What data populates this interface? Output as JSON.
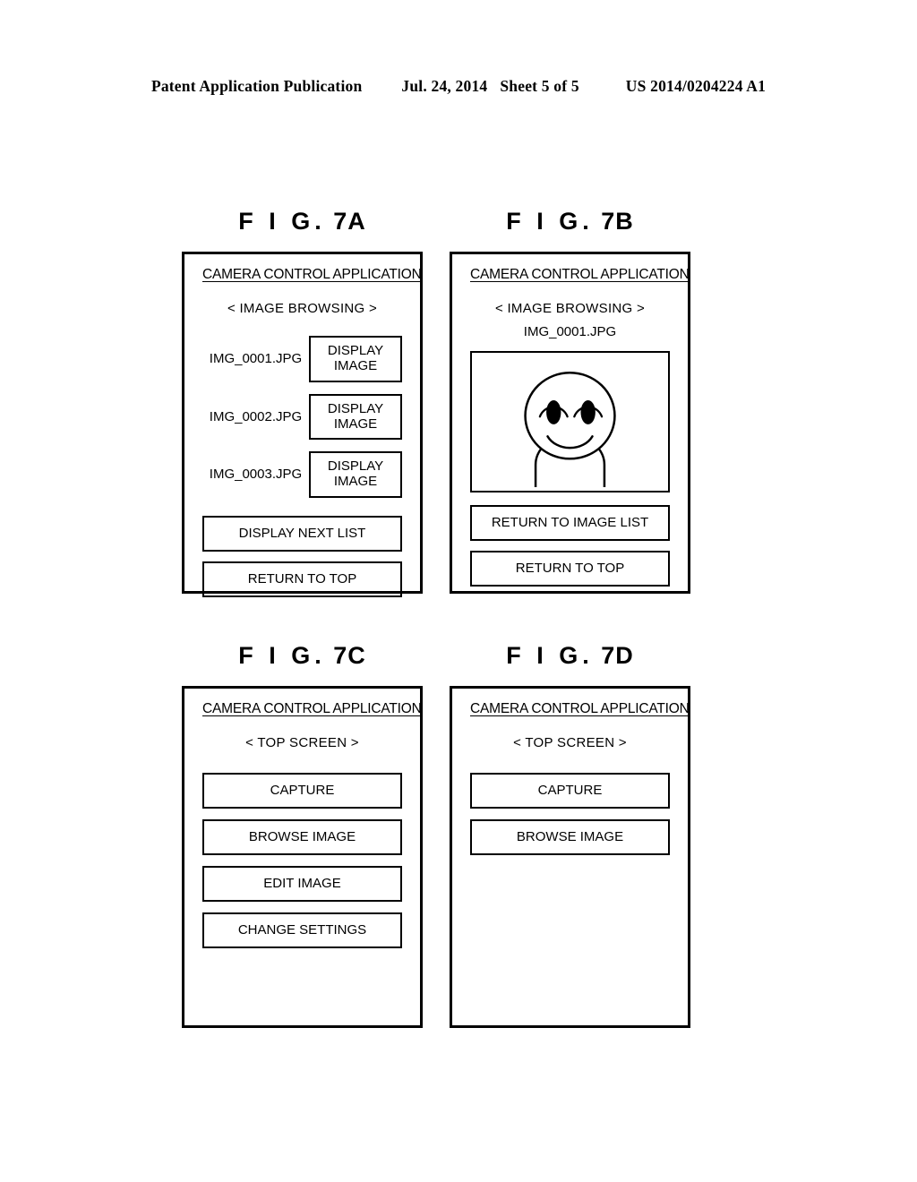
{
  "page_header": {
    "publication": "Patent Application Publication",
    "date": "Jul. 24, 2014",
    "sheet": "Sheet 5 of 5",
    "number": "US 2014/0204224 A1"
  },
  "figures": [
    {
      "caption_prefix": "F I G.",
      "caption_label": "7A",
      "app_title": "CAMERA CONTROL APPLICATION",
      "screen_name": "< IMAGE BROWSING >",
      "list": [
        {
          "file": "IMG_0001.JPG",
          "button_line1": "DISPLAY",
          "button_line2": "IMAGE"
        },
        {
          "file": "IMG_0002.JPG",
          "button_line1": "DISPLAY",
          "button_line2": "IMAGE"
        },
        {
          "file": "IMG_0003.JPG",
          "button_line1": "DISPLAY",
          "button_line2": "IMAGE"
        }
      ],
      "buttons": [
        {
          "label": "DISPLAY NEXT LIST"
        },
        {
          "label": "RETURN TO TOP"
        }
      ]
    },
    {
      "caption_prefix": "F I G.",
      "caption_label": "7B",
      "app_title": "CAMERA CONTROL APPLICATION",
      "screen_name": "< IMAGE BROWSING >",
      "file_name": "IMG_0001.JPG",
      "photo": "smiling-person-portrait",
      "buttons": [
        {
          "label": "RETURN TO IMAGE LIST"
        },
        {
          "label": "RETURN TO TOP"
        }
      ]
    },
    {
      "caption_prefix": "F I G.",
      "caption_label": "7C",
      "app_title": "CAMERA CONTROL APPLICATION",
      "screen_name": "< TOP SCREEN >",
      "buttons": [
        {
          "label": "CAPTURE"
        },
        {
          "label": "BROWSE IMAGE"
        },
        {
          "label": "EDIT IMAGE"
        },
        {
          "label": "CHANGE SETTINGS"
        }
      ]
    },
    {
      "caption_prefix": "F I G.",
      "caption_label": "7D",
      "app_title": "CAMERA CONTROL APPLICATION",
      "screen_name": "< TOP SCREEN >",
      "buttons": [
        {
          "label": "CAPTURE"
        },
        {
          "label": "BROWSE IMAGE"
        }
      ]
    }
  ],
  "colors": {
    "ink": "#000000",
    "paper": "#ffffff"
  }
}
